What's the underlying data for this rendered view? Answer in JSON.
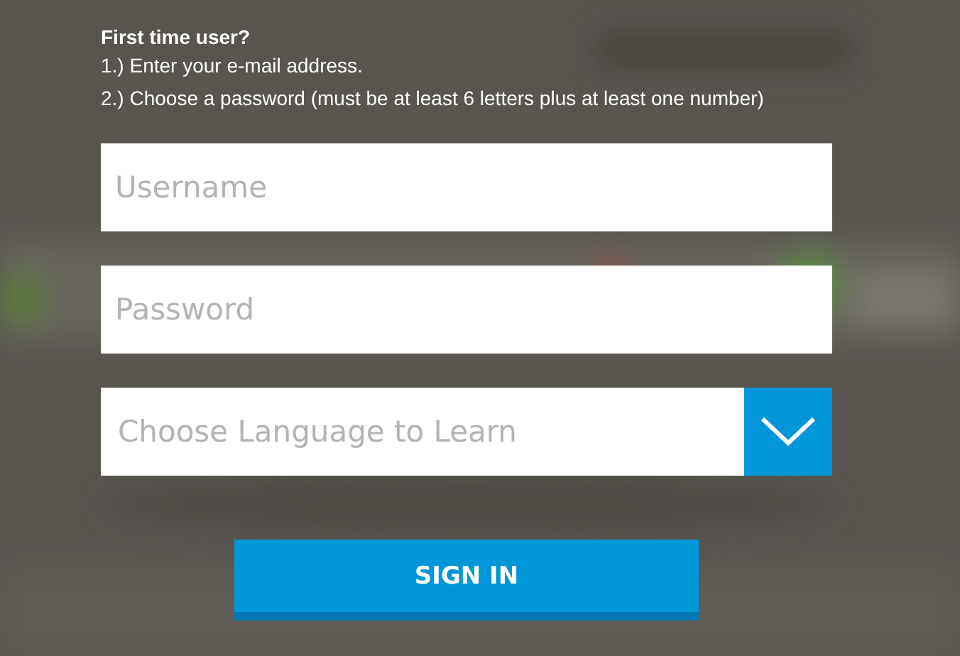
{
  "intro": {
    "title": "First time user?",
    "steps": [
      "1.) Enter your e-mail address.",
      "2.) Choose a password (must be at least 6 letters plus at least one number)"
    ]
  },
  "fields": [
    {
      "kind": "text",
      "placeholder": "Username"
    },
    {
      "kind": "password",
      "placeholder": "Password"
    },
    {
      "kind": "select",
      "placeholder": "Choose Language to Learn"
    }
  ],
  "button": "SIGN IN"
}
